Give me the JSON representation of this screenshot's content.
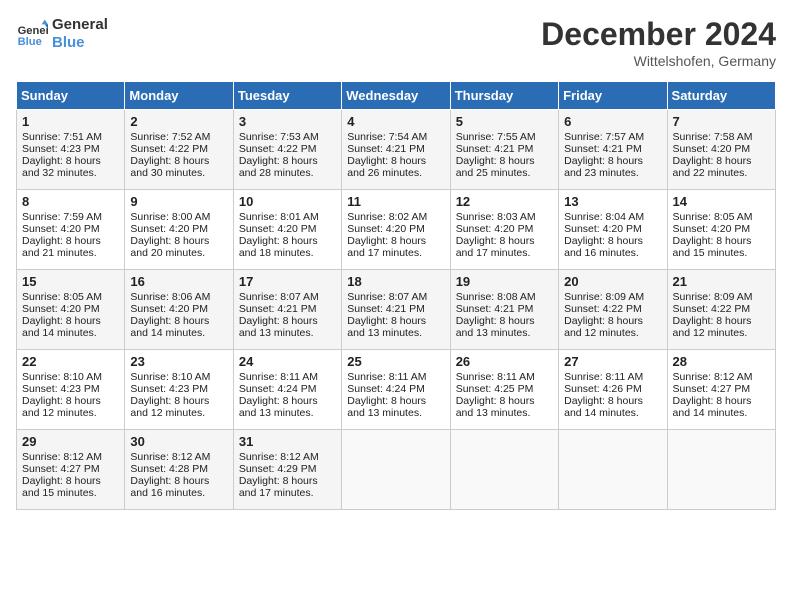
{
  "header": {
    "logo_line1": "General",
    "logo_line2": "Blue",
    "month": "December 2024",
    "location": "Wittelshofen, Germany"
  },
  "weekdays": [
    "Sunday",
    "Monday",
    "Tuesday",
    "Wednesday",
    "Thursday",
    "Friday",
    "Saturday"
  ],
  "weeks": [
    [
      {
        "day": "1",
        "rise": "Sunrise: 7:51 AM",
        "set": "Sunset: 4:23 PM",
        "daylight": "Daylight: 8 hours and 32 minutes."
      },
      {
        "day": "2",
        "rise": "Sunrise: 7:52 AM",
        "set": "Sunset: 4:22 PM",
        "daylight": "Daylight: 8 hours and 30 minutes."
      },
      {
        "day": "3",
        "rise": "Sunrise: 7:53 AM",
        "set": "Sunset: 4:22 PM",
        "daylight": "Daylight: 8 hours and 28 minutes."
      },
      {
        "day": "4",
        "rise": "Sunrise: 7:54 AM",
        "set": "Sunset: 4:21 PM",
        "daylight": "Daylight: 8 hours and 26 minutes."
      },
      {
        "day": "5",
        "rise": "Sunrise: 7:55 AM",
        "set": "Sunset: 4:21 PM",
        "daylight": "Daylight: 8 hours and 25 minutes."
      },
      {
        "day": "6",
        "rise": "Sunrise: 7:57 AM",
        "set": "Sunset: 4:21 PM",
        "daylight": "Daylight: 8 hours and 23 minutes."
      },
      {
        "day": "7",
        "rise": "Sunrise: 7:58 AM",
        "set": "Sunset: 4:20 PM",
        "daylight": "Daylight: 8 hours and 22 minutes."
      }
    ],
    [
      {
        "day": "8",
        "rise": "Sunrise: 7:59 AM",
        "set": "Sunset: 4:20 PM",
        "daylight": "Daylight: 8 hours and 21 minutes."
      },
      {
        "day": "9",
        "rise": "Sunrise: 8:00 AM",
        "set": "Sunset: 4:20 PM",
        "daylight": "Daylight: 8 hours and 20 minutes."
      },
      {
        "day": "10",
        "rise": "Sunrise: 8:01 AM",
        "set": "Sunset: 4:20 PM",
        "daylight": "Daylight: 8 hours and 18 minutes."
      },
      {
        "day": "11",
        "rise": "Sunrise: 8:02 AM",
        "set": "Sunset: 4:20 PM",
        "daylight": "Daylight: 8 hours and 17 minutes."
      },
      {
        "day": "12",
        "rise": "Sunrise: 8:03 AM",
        "set": "Sunset: 4:20 PM",
        "daylight": "Daylight: 8 hours and 17 minutes."
      },
      {
        "day": "13",
        "rise": "Sunrise: 8:04 AM",
        "set": "Sunset: 4:20 PM",
        "daylight": "Daylight: 8 hours and 16 minutes."
      },
      {
        "day": "14",
        "rise": "Sunrise: 8:05 AM",
        "set": "Sunset: 4:20 PM",
        "daylight": "Daylight: 8 hours and 15 minutes."
      }
    ],
    [
      {
        "day": "15",
        "rise": "Sunrise: 8:05 AM",
        "set": "Sunset: 4:20 PM",
        "daylight": "Daylight: 8 hours and 14 minutes."
      },
      {
        "day": "16",
        "rise": "Sunrise: 8:06 AM",
        "set": "Sunset: 4:20 PM",
        "daylight": "Daylight: 8 hours and 14 minutes."
      },
      {
        "day": "17",
        "rise": "Sunrise: 8:07 AM",
        "set": "Sunset: 4:21 PM",
        "daylight": "Daylight: 8 hours and 13 minutes."
      },
      {
        "day": "18",
        "rise": "Sunrise: 8:07 AM",
        "set": "Sunset: 4:21 PM",
        "daylight": "Daylight: 8 hours and 13 minutes."
      },
      {
        "day": "19",
        "rise": "Sunrise: 8:08 AM",
        "set": "Sunset: 4:21 PM",
        "daylight": "Daylight: 8 hours and 13 minutes."
      },
      {
        "day": "20",
        "rise": "Sunrise: 8:09 AM",
        "set": "Sunset: 4:22 PM",
        "daylight": "Daylight: 8 hours and 12 minutes."
      },
      {
        "day": "21",
        "rise": "Sunrise: 8:09 AM",
        "set": "Sunset: 4:22 PM",
        "daylight": "Daylight: 8 hours and 12 minutes."
      }
    ],
    [
      {
        "day": "22",
        "rise": "Sunrise: 8:10 AM",
        "set": "Sunset: 4:23 PM",
        "daylight": "Daylight: 8 hours and 12 minutes."
      },
      {
        "day": "23",
        "rise": "Sunrise: 8:10 AM",
        "set": "Sunset: 4:23 PM",
        "daylight": "Daylight: 8 hours and 12 minutes."
      },
      {
        "day": "24",
        "rise": "Sunrise: 8:11 AM",
        "set": "Sunset: 4:24 PM",
        "daylight": "Daylight: 8 hours and 13 minutes."
      },
      {
        "day": "25",
        "rise": "Sunrise: 8:11 AM",
        "set": "Sunset: 4:24 PM",
        "daylight": "Daylight: 8 hours and 13 minutes."
      },
      {
        "day": "26",
        "rise": "Sunrise: 8:11 AM",
        "set": "Sunset: 4:25 PM",
        "daylight": "Daylight: 8 hours and 13 minutes."
      },
      {
        "day": "27",
        "rise": "Sunrise: 8:11 AM",
        "set": "Sunset: 4:26 PM",
        "daylight": "Daylight: 8 hours and 14 minutes."
      },
      {
        "day": "28",
        "rise": "Sunrise: 8:12 AM",
        "set": "Sunset: 4:27 PM",
        "daylight": "Daylight: 8 hours and 14 minutes."
      }
    ],
    [
      {
        "day": "29",
        "rise": "Sunrise: 8:12 AM",
        "set": "Sunset: 4:27 PM",
        "daylight": "Daylight: 8 hours and 15 minutes."
      },
      {
        "day": "30",
        "rise": "Sunrise: 8:12 AM",
        "set": "Sunset: 4:28 PM",
        "daylight": "Daylight: 8 hours and 16 minutes."
      },
      {
        "day": "31",
        "rise": "Sunrise: 8:12 AM",
        "set": "Sunset: 4:29 PM",
        "daylight": "Daylight: 8 hours and 17 minutes."
      },
      null,
      null,
      null,
      null
    ]
  ]
}
